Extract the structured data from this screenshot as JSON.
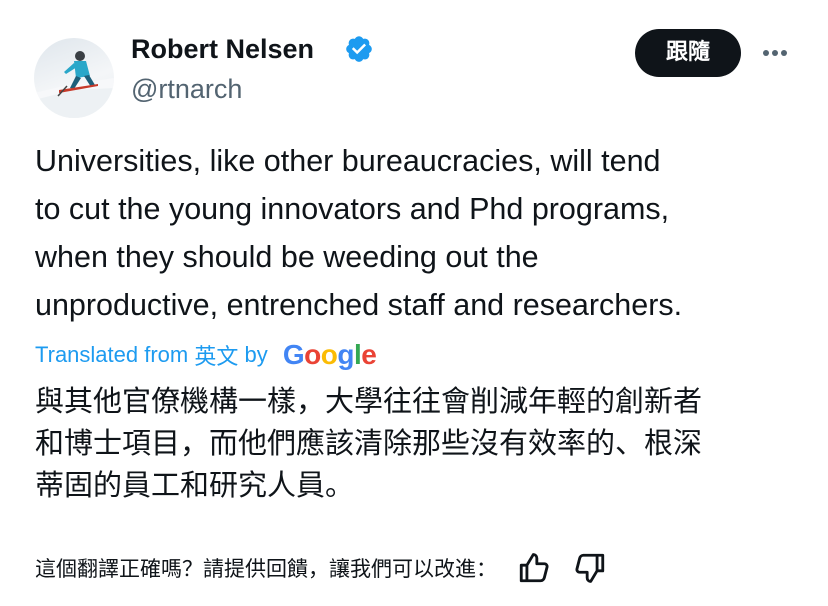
{
  "author": {
    "name": "Robert Nelsen",
    "handle": "@rtnarch",
    "verified": true
  },
  "follow_button_label": "跟隨",
  "more_icon": "more-horizontal-icon",
  "tweet": {
    "lines": [
      "Universities, like other bureaucracies, will tend",
      "to cut the young innovators and Phd programs,",
      "when they should be weeding out the",
      "unproductive, entrenched staff and researchers."
    ]
  },
  "translation": {
    "prefix": "Translated from ",
    "source_language": "英文",
    "by": " by ",
    "provider": [
      "G",
      "o",
      "o",
      "g",
      "l",
      "e"
    ],
    "lines": [
      "與其他官僚機構一樣，大學往往會削減年輕的創新者",
      "和博士項目，而他們應該清除那些沒有效率的、根深",
      "蒂固的員工和研究人員。"
    ]
  },
  "feedback": {
    "prompt": "這個翻譯正確嗎？請提供回饋，讓我們可以改進：",
    "icons": [
      "thumbs-up-icon",
      "thumbs-down-icon"
    ]
  },
  "colors": {
    "accent": "#1d9bf0",
    "text": "#0f1419",
    "secondary": "#536471",
    "google": [
      "#4285F4",
      "#EA4335",
      "#FBBC05",
      "#4285F4",
      "#34A853",
      "#EA4335"
    ]
  }
}
